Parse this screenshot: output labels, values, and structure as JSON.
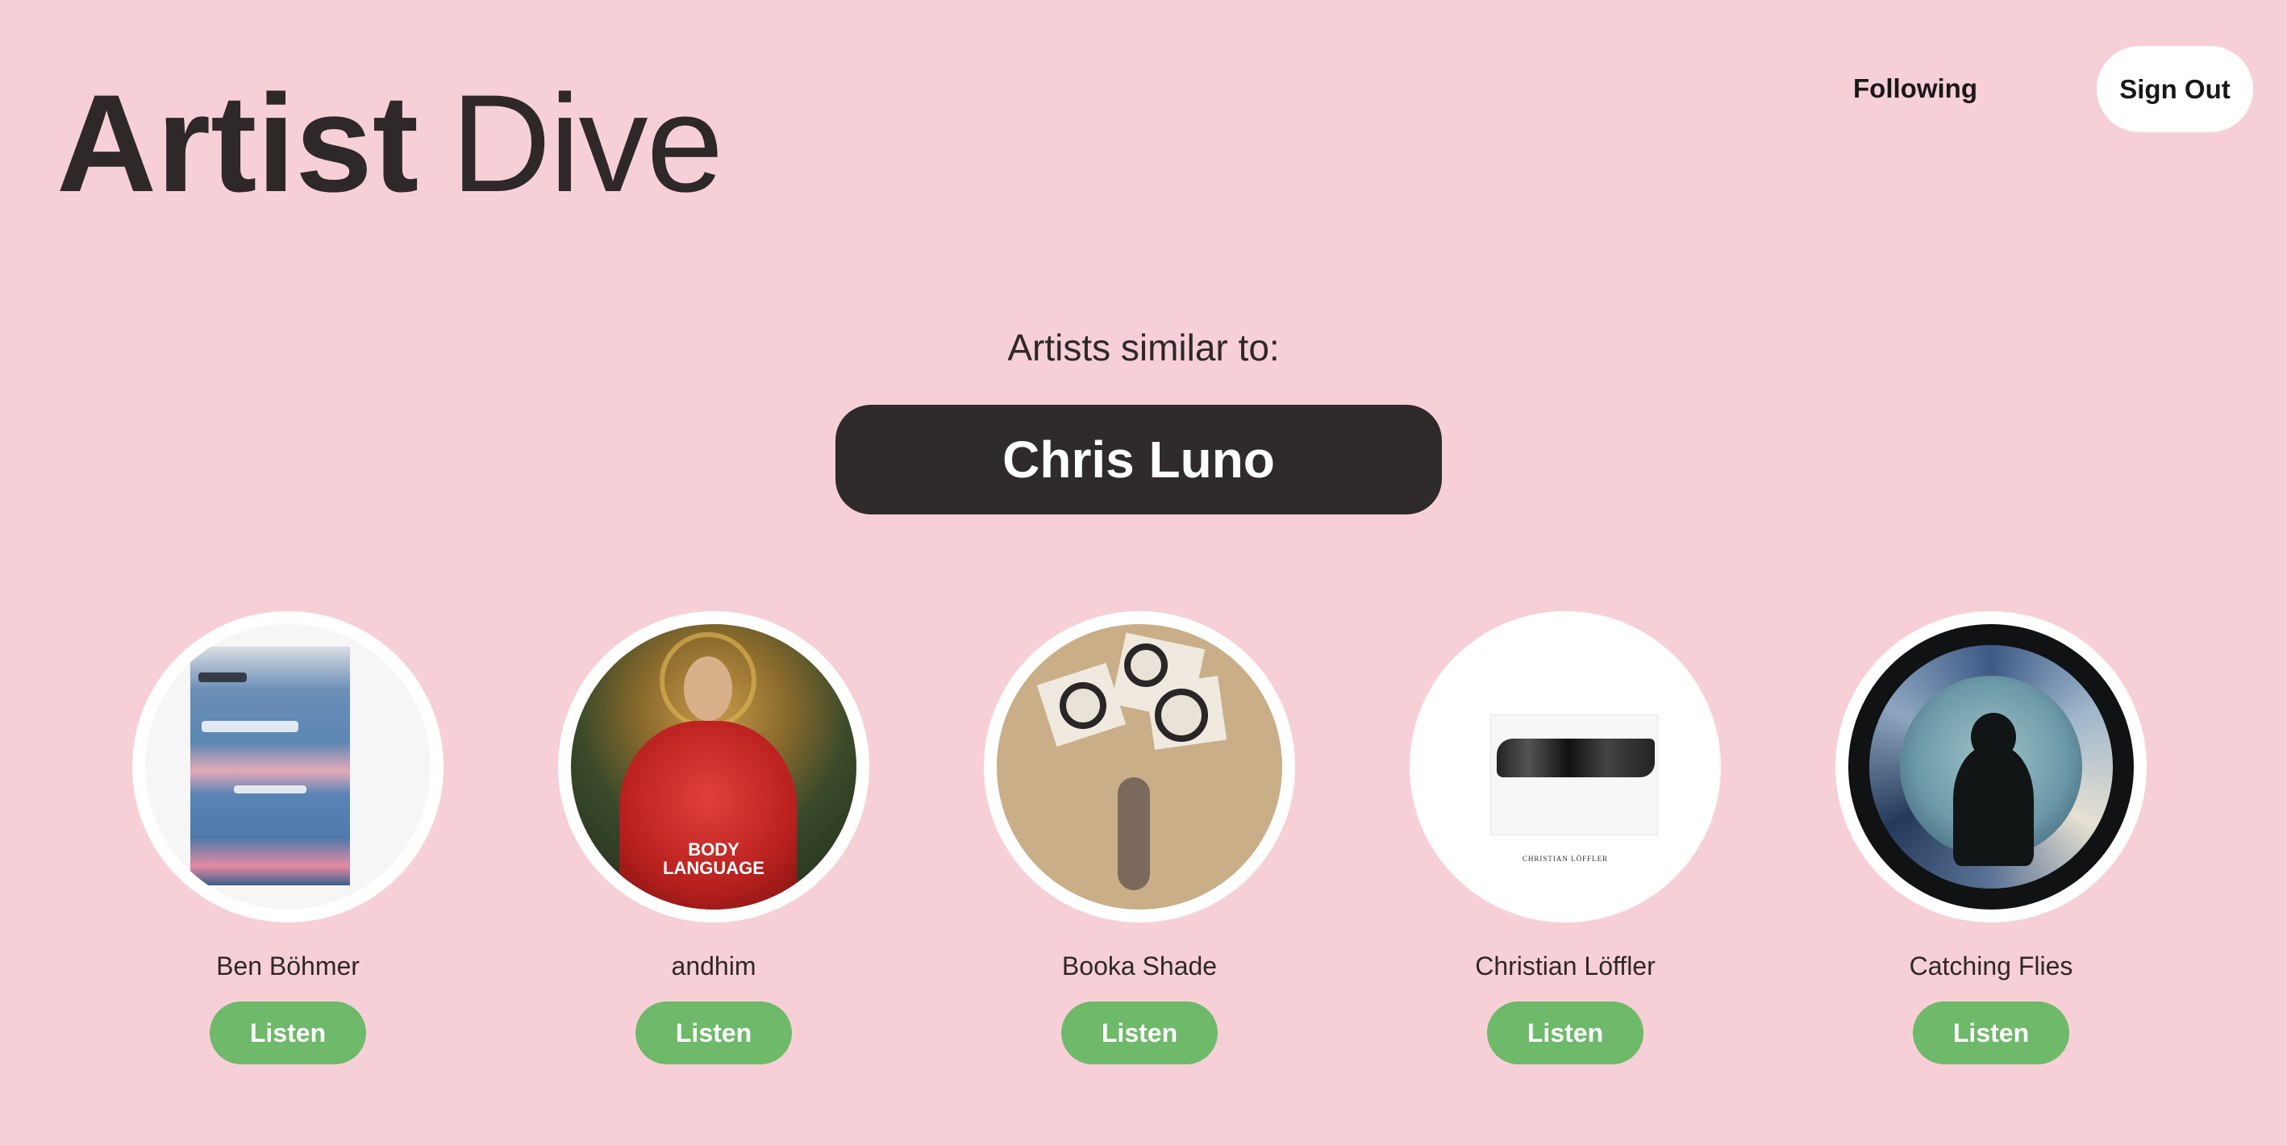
{
  "header": {
    "logo_bold": "Artist",
    "logo_light": "Dive",
    "nav": {
      "following": "Following",
      "sign_out": "Sign Out"
    }
  },
  "hero": {
    "label": "Artists similar to:",
    "artist": "Chris Luno"
  },
  "artists": [
    {
      "name": "Ben Böhmer",
      "button": "Listen"
    },
    {
      "name": "andhim",
      "button": "Listen",
      "cover_text": "BODY\nLANGUAGE"
    },
    {
      "name": "Booka Shade",
      "button": "Listen"
    },
    {
      "name": "Christian Löffler",
      "button": "Listen",
      "cover_text": "CHRISTIAN LÖFFLER"
    },
    {
      "name": "Catching Flies",
      "button": "Listen"
    }
  ],
  "colors": {
    "background": "#f7d0d7",
    "pill": "#2f2a2b",
    "listen_button": "#6eb96a",
    "sign_out_button": "#ffffff"
  },
  "icons": [
    "album-cover-image"
  ]
}
